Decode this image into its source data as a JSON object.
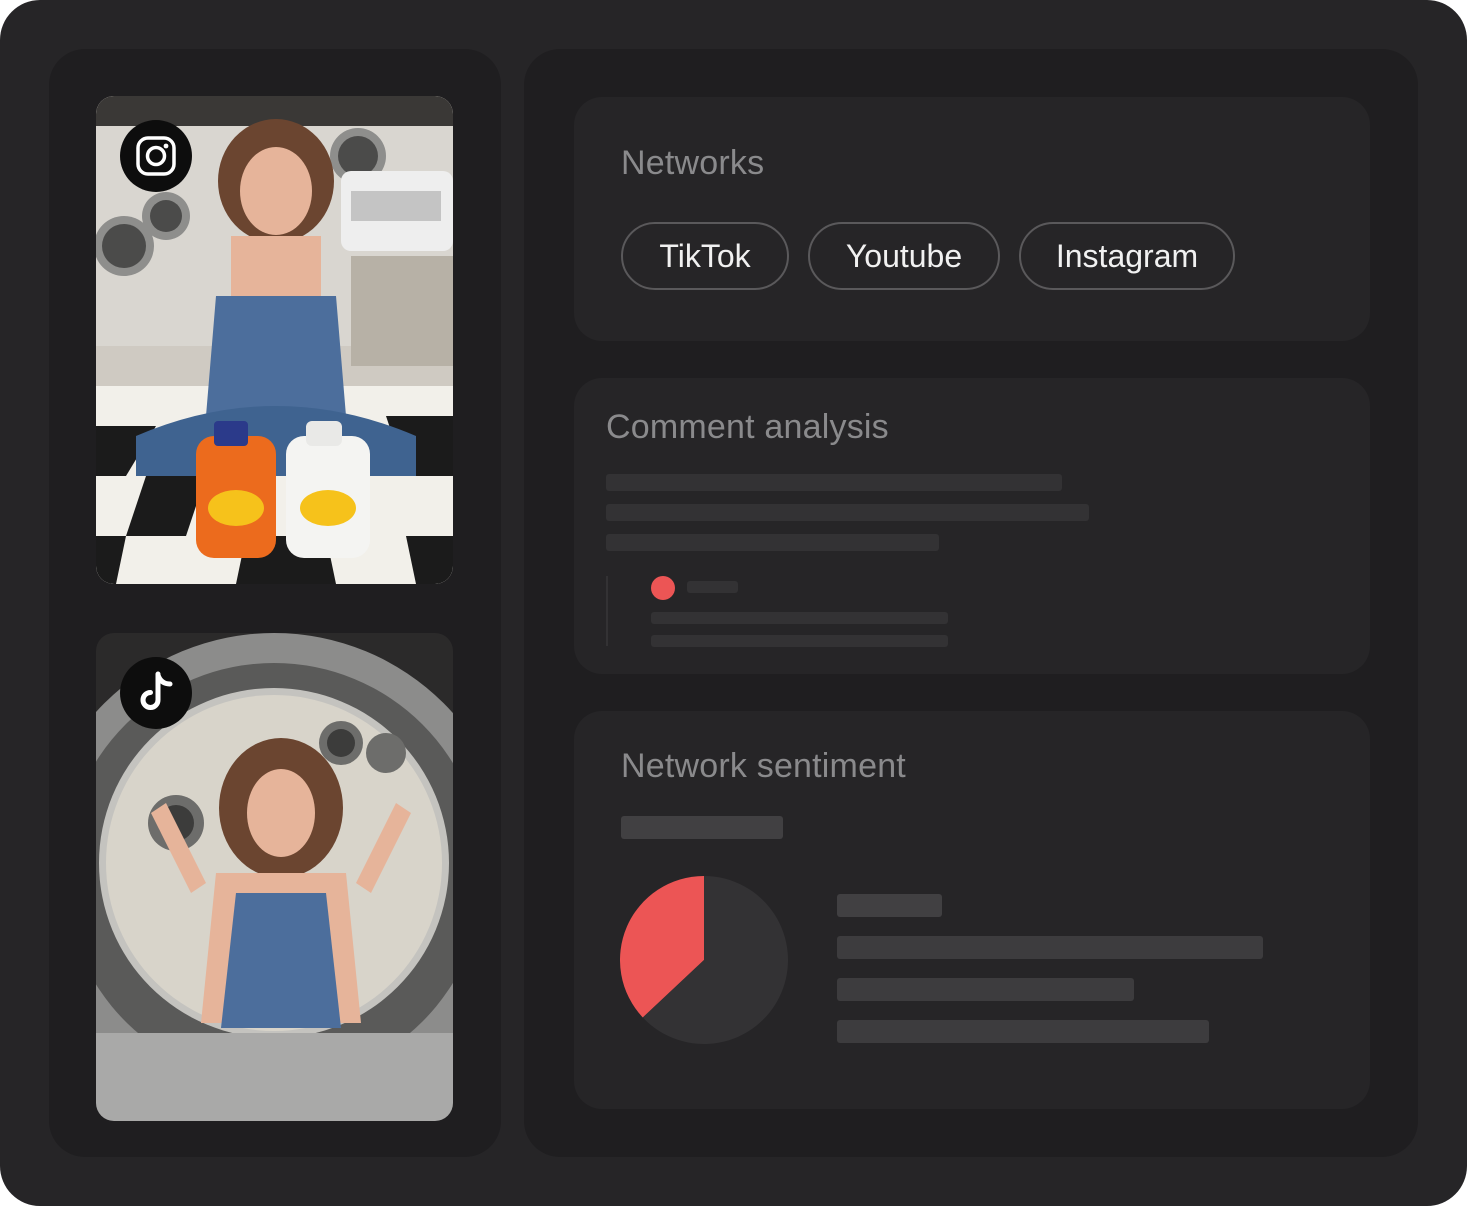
{
  "posts": [
    {
      "network_icon": "instagram-icon",
      "photo_alt": "instagram-post-photo"
    },
    {
      "network_icon": "tiktok-icon",
      "photo_alt": "tiktok-post-photo"
    }
  ],
  "networks": {
    "title": "Networks",
    "chips": [
      "TikTok",
      "Youtube",
      "Instagram"
    ]
  },
  "comment_analysis": {
    "title": "Comment analysis",
    "comment_dot_color": "#ec5555"
  },
  "network_sentiment": {
    "title": "Network sentiment",
    "chart_data": {
      "type": "pie",
      "slices": [
        {
          "value": 37,
          "color": "#ec5555"
        },
        {
          "value": 63,
          "color": "#333234"
        }
      ]
    }
  }
}
